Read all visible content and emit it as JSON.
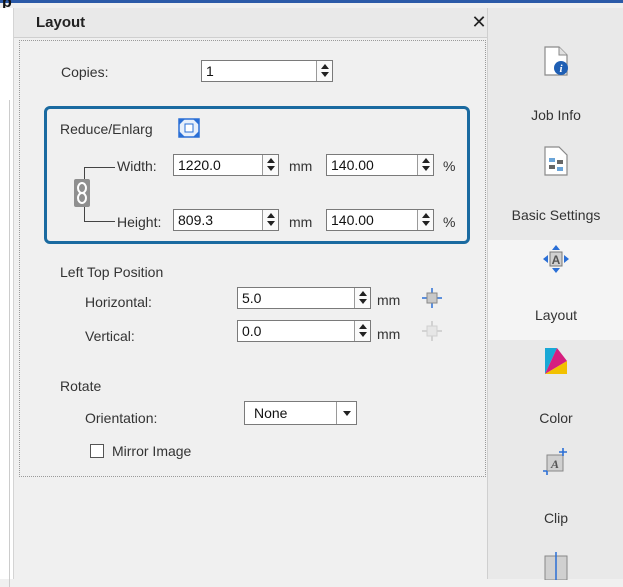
{
  "app": {
    "title_fragment": "p"
  },
  "panel": {
    "title": "Layout",
    "close_glyph": "✕",
    "copies": {
      "label": "Copies:",
      "value": "1"
    },
    "reduce": {
      "label": "Reduce/Enlarg",
      "width_label": "Width:",
      "width_value": "1220.0",
      "width_unit": "mm",
      "width_percent": "140.00",
      "percent_unit": "%",
      "height_label": "Height:",
      "height_value": "809.3",
      "height_unit": "mm",
      "height_percent": "140.00"
    },
    "position": {
      "label": "Left Top Position",
      "horizontal_label": "Horizontal:",
      "horizontal_value": "5.0",
      "vertical_label": "Vertical:",
      "vertical_value": "0.0",
      "unit": "mm"
    },
    "rotate": {
      "label": "Rotate",
      "orientation_label": "Orientation:",
      "orientation_value": "None",
      "mirror_label": "Mirror Image",
      "mirror_checked": false
    }
  },
  "sidebar": {
    "items": [
      {
        "label": "Job Info",
        "icon": "job-info-icon"
      },
      {
        "label": "Basic Settings",
        "icon": "basic-settings-icon"
      },
      {
        "label": "Layout",
        "icon": "layout-icon",
        "active": true
      },
      {
        "label": "Color",
        "icon": "color-icon"
      },
      {
        "label": "Clip",
        "icon": "clip-icon"
      },
      {
        "label": "",
        "icon": "mirror-icon"
      }
    ]
  },
  "colors": {
    "accent": "#1a6aa0",
    "title_bar": "#2b5aa8"
  }
}
